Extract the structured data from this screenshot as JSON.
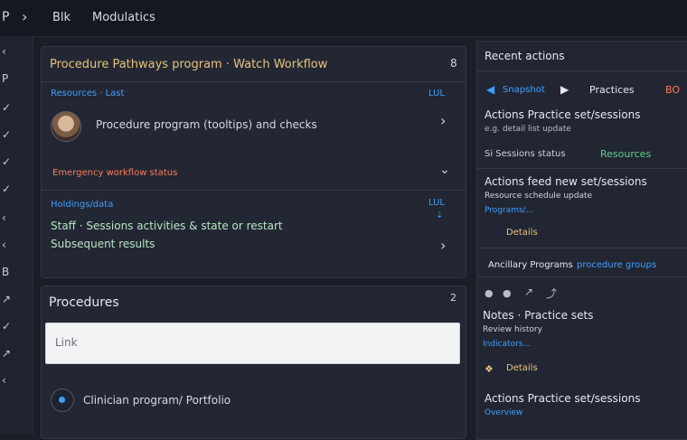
{
  "topbar": {
    "left_glyph": "P",
    "chevron": "›",
    "crumb1": "Blk",
    "crumb2": "Modulatics"
  },
  "left_rail": {
    "items": [
      "‹",
      "P",
      "✓",
      "✓",
      "✓",
      "✓",
      "‹",
      "‹",
      "B",
      "↗",
      "✓",
      "↗",
      "‹"
    ]
  },
  "card_main": {
    "header_title": "Procedure Pathways program · Watch Workflow",
    "header_right": "8",
    "section1": {
      "label": "Resources · Last",
      "right_label": "LUL",
      "item_text": "Procedure program (tooltips) and checks",
      "chevron": "›"
    },
    "section2": {
      "label": "Emergency workflow status",
      "chevron": "⌄"
    },
    "section3": {
      "label": "Holdings/data",
      "right_top": "LUL",
      "right_bottom": "⇣",
      "line1": "Staff · Sessions activities & state or restart",
      "line2": "Subsequent results",
      "chevron": "›"
    }
  },
  "card_secondary": {
    "title": "Procedures",
    "right_num": "2",
    "input_placeholder": "Link",
    "footer_text": "Clinician program/ Portfolio"
  },
  "right_panel": {
    "title": "Recent actions",
    "tabs": [
      {
        "label": "Snapshot",
        "active": true
      },
      {
        "label": "Practices",
        "active": false
      },
      {
        "label": "BO",
        "active": false
      }
    ],
    "entry1": {
      "title": "Actions Practice set/sessions",
      "meta": "e.g. detail list update"
    },
    "row1": {
      "left": "Si Sessions status",
      "right": "Resources"
    },
    "entry2": {
      "title": "Actions feed new set/sessions",
      "sub1": "Resource schedule update",
      "link": "Programs/...",
      "tag": "Details"
    },
    "section_header": {
      "label": "Ancillary Programs",
      "link": "procedure groups"
    },
    "icons_row": [
      "●",
      "●",
      "↗",
      "⤴"
    ],
    "entry3": {
      "title": "Notes · Practice sets",
      "meta": "Review history",
      "link": "Indicators..."
    },
    "entry4": {
      "tag": "Details",
      "title": "Actions Practice set/sessions",
      "link": "Overview"
    }
  },
  "colors": {
    "accent_blue": "#3aa0ff",
    "accent_orange": "#ff7a59",
    "accent_green": "#5fd08a",
    "bg": "#1b1e27"
  }
}
